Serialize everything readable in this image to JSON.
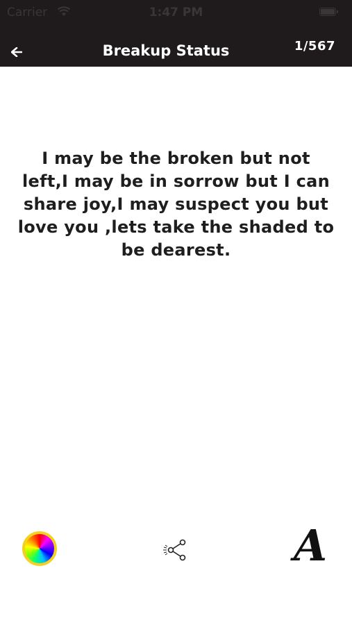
{
  "status_bar": {
    "carrier": "Carrier",
    "time": "1:47 PM"
  },
  "nav": {
    "back_icon": "arrow-left-icon",
    "title": "Breakup Status",
    "counter": "1/567"
  },
  "quote": {
    "text": "I may be the broken but not left,I may be in sorrow but I can share joy,I may suspect you but love you ,lets take the shaded to be dearest."
  },
  "toolbar": {
    "items": [
      {
        "icon": "color-wheel-icon",
        "ring_color": "#f2d21e"
      },
      {
        "icon": "share-icon"
      },
      {
        "icon": "font-icon",
        "label": "A"
      }
    ]
  },
  "colors": {
    "nav_background": "#1f1a1b",
    "nav_text": "#ffffff",
    "quote_text": "#1e1e1e"
  }
}
